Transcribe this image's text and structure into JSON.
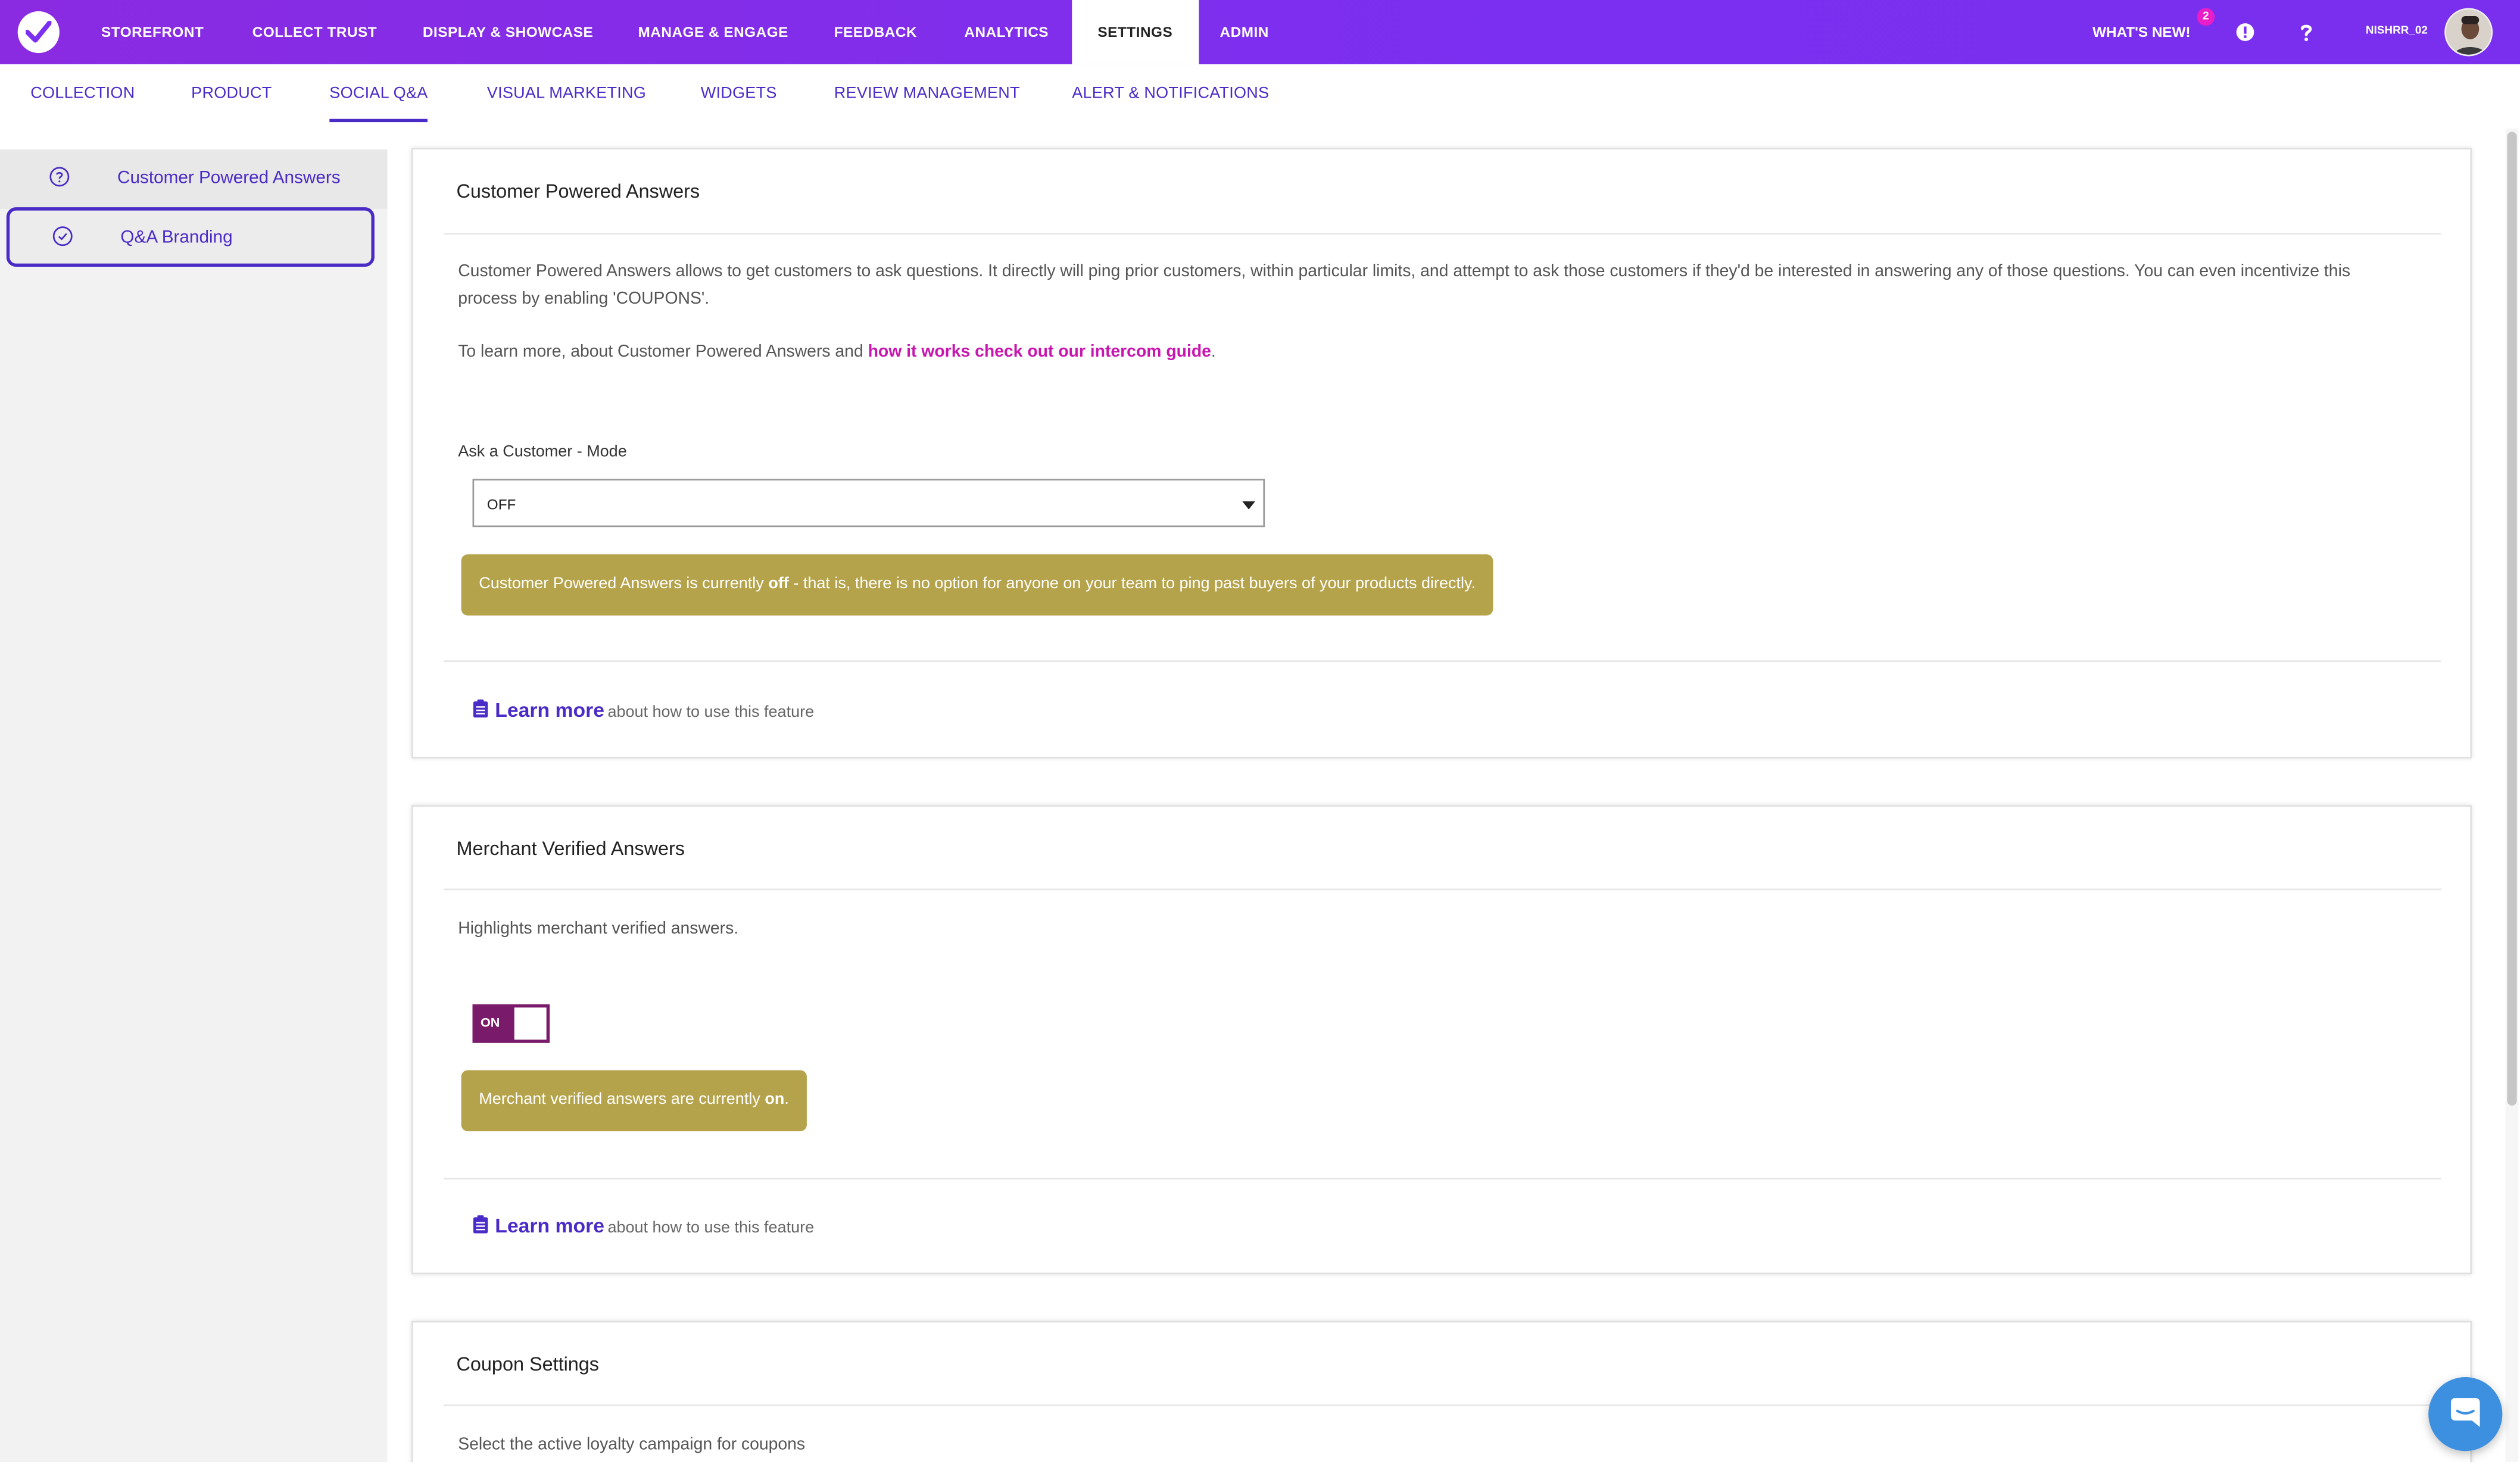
{
  "topnav": {
    "items": [
      "STOREFRONT",
      "COLLECT TRUST",
      "DISPLAY & SHOWCASE",
      "MANAGE & ENGAGE",
      "FEEDBACK",
      "ANALYTICS",
      "SETTINGS",
      "ADMIN"
    ],
    "active": "SETTINGS",
    "whats_new": "WHAT'S NEW!",
    "whats_new_count": "2",
    "username": "NISHRR_02"
  },
  "subnav": {
    "items": [
      "COLLECTION",
      "PRODUCT",
      "SOCIAL Q&A",
      "VISUAL MARKETING",
      "WIDGETS",
      "REVIEW MANAGEMENT",
      "ALERT & NOTIFICATIONS"
    ],
    "active": "SOCIAL Q&A"
  },
  "sidebar": {
    "items": [
      {
        "label": "Customer Powered Answers",
        "icon": "question-circle-icon"
      },
      {
        "label": "Q&A Branding",
        "icon": "check-circle-icon"
      }
    ]
  },
  "cpa": {
    "title": "Customer Powered Answers",
    "description": "Customer Powered Answers allows to get customers to ask questions. It directly will ping prior customers, within particular limits, and attempt to ask those customers if they'd be interested in answering any of those questions. You can even incentivize this process by enabling 'COUPONS'.",
    "learn_prefix": "To learn more, about Customer Powered Answers and ",
    "learn_link": "how it works check out our intercom guide",
    "learn_suffix": ".",
    "mode_label": "Ask a Customer - Mode",
    "mode_value": "OFF",
    "notice_prefix": "Customer Powered Answers is currently ",
    "notice_strong": "off",
    "notice_suffix": " - that is, there is no option for anyone on your team to ping past buyers of your products directly.",
    "learn_more": "Learn more",
    "learn_more_rest": "about how to use this feature"
  },
  "mva": {
    "title": "Merchant Verified Answers",
    "description": "Highlights merchant verified answers.",
    "toggle_label": "ON",
    "notice_prefix": "Merchant verified answers are currently ",
    "notice_strong": "on",
    "notice_suffix": ".",
    "learn_more": "Learn more",
    "learn_more_rest": "about how to use this feature"
  },
  "coupon": {
    "title": "Coupon Settings",
    "description": "Select the active loyalty campaign for coupons"
  },
  "colors": {
    "brand": "#7b2ff0",
    "accent_text": "#4a2bc7",
    "link": "#c815b0",
    "notice_bg": "#b5a34b",
    "toggle_bg": "#7a1a6a"
  }
}
